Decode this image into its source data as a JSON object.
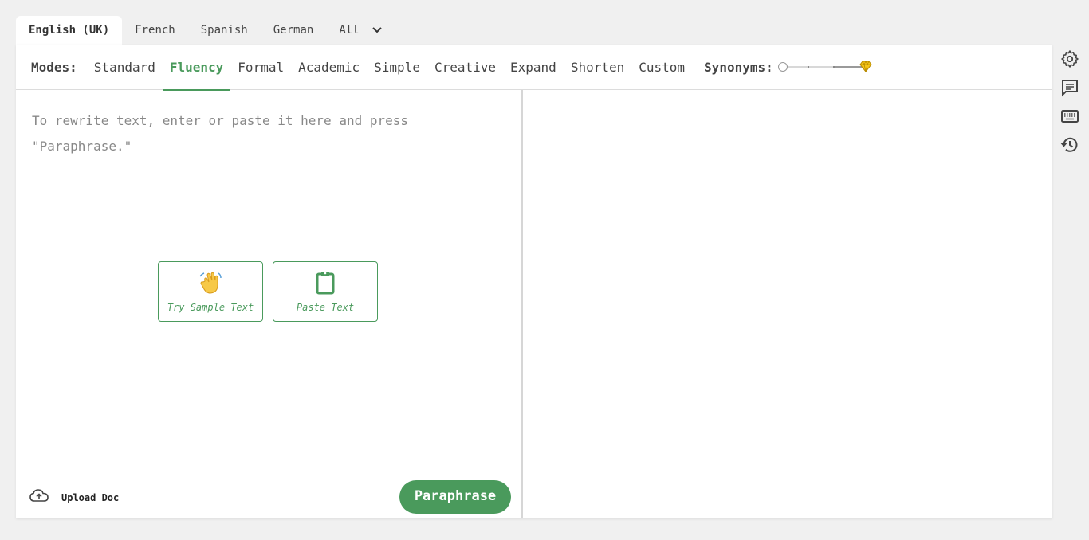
{
  "languages": {
    "tabs": [
      "English (UK)",
      "French",
      "Spanish",
      "German"
    ],
    "all_label": "All",
    "active": "English (UK)"
  },
  "modes": {
    "label": "Modes:",
    "items": [
      "Standard",
      "Fluency",
      "Formal",
      "Academic",
      "Simple",
      "Creative",
      "Expand",
      "Shorten",
      "Custom"
    ],
    "active": "Fluency"
  },
  "synonyms": {
    "label": "Synonyms:",
    "level": 0
  },
  "editor": {
    "placeholder_line1": "To rewrite text, enter or paste it here and press",
    "placeholder_line2": "\"Paraphrase.\""
  },
  "actions": {
    "sample_label": "Try Sample Text",
    "paste_label": "Paste Text"
  },
  "footer": {
    "upload_label": "Upload Doc",
    "paraphrase_label": "Paraphrase"
  },
  "colors": {
    "accent": "#4a9a5c",
    "gem": "#f5c518"
  },
  "side_icons": [
    "gear-icon",
    "comment-icon",
    "keyboard-icon",
    "history-icon"
  ]
}
